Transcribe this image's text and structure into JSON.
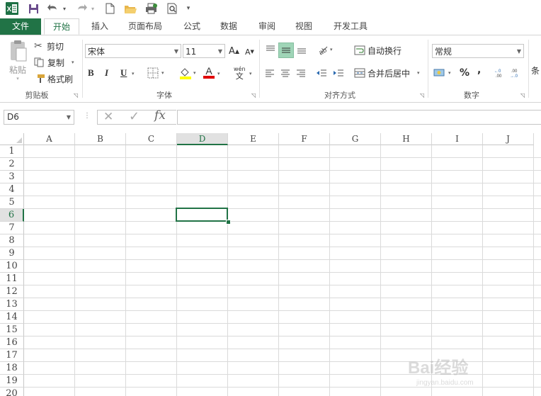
{
  "qat": {
    "app_icon": "excel-logo",
    "buttons": [
      "save-icon",
      "undo-icon",
      "redo-icon",
      "new-doc-icon",
      "open-folder-icon",
      "print-icon",
      "print-preview-icon",
      "customize-icon"
    ]
  },
  "tabs": [
    {
      "label": "文件"
    },
    {
      "label": "开始"
    },
    {
      "label": "插入"
    },
    {
      "label": "页面布局"
    },
    {
      "label": "公式"
    },
    {
      "label": "数据"
    },
    {
      "label": "审阅"
    },
    {
      "label": "视图"
    },
    {
      "label": "开发工具"
    }
  ],
  "ribbon": {
    "clipboard": {
      "paste_label": "粘贴",
      "cut_label": "剪切",
      "copy_label": "复制",
      "format_painter_label": "格式刷",
      "group_label": "剪贴板"
    },
    "font": {
      "font_name": "宋体",
      "font_size": "11",
      "bold": "B",
      "italic": "I",
      "underline": "U",
      "phonetic_top": "wén",
      "phonetic_bottom": "文",
      "grow": "A",
      "shrink": "A",
      "font_color_glyph": "A",
      "group_label": "字体"
    },
    "alignment": {
      "wrap_text_label": "自动换行",
      "merge_center_label": "合并后居中",
      "group_label": "对齐方式"
    },
    "number": {
      "format": "常规",
      "percent": "%",
      "comma": ",",
      "group_label": "数字"
    },
    "styles": {
      "partial_label": "条"
    }
  },
  "formula_bar": {
    "name_box": "D6",
    "cancel_glyph": "✕",
    "enter_glyph": "✓",
    "fx_glyph": "fx",
    "value": ""
  },
  "sheet": {
    "columns": [
      "A",
      "B",
      "C",
      "D",
      "E",
      "F",
      "G",
      "H",
      "I",
      "J"
    ],
    "rows": [
      "1",
      "2",
      "3",
      "4",
      "5",
      "6",
      "7",
      "8",
      "9",
      "10",
      "11",
      "12",
      "13",
      "14",
      "15",
      "16",
      "17",
      "18",
      "19",
      "20"
    ],
    "selected_column": "D",
    "selected_row": "6"
  },
  "watermark": {
    "text": "Bai经验",
    "subtext": "jingyan.baidu.com"
  },
  "colors": {
    "accent": "#217346",
    "header_selected_bg": "#e1e1e1",
    "gridline": "#dadada"
  }
}
